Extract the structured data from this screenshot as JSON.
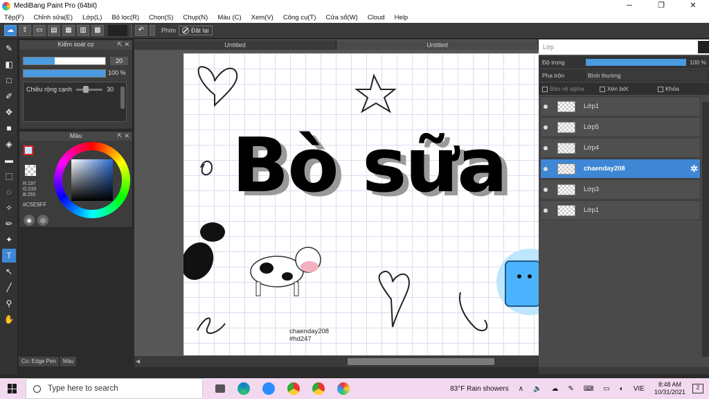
{
  "window": {
    "title": "MediBang Paint Pro (64bit)",
    "minimize": "─",
    "maximize": "❐",
    "close": "✕"
  },
  "menu": [
    "Tệp(F)",
    "Chỉnh sửa(E)",
    "Lớp(L)",
    "Bộ lọc(R)",
    "Chọn(S)",
    "Chụp(N)",
    "Màu (C)",
    "Xem(V)",
    "Công cụ(T)",
    "Cửa sổ(W)",
    "Cloud",
    "Help"
  ],
  "toolbar": {
    "label": "Phím",
    "reset": "Đặt lại"
  },
  "brush_panel": {
    "title": "Kiểm soát cọ",
    "size_value": "20",
    "size_fraction": 0.38,
    "opacity_value": "100 %",
    "opacity_fraction": 1.0,
    "width_label": "Chiều rộng cạnh",
    "width_value": "30"
  },
  "color_panel": {
    "title": "Màu",
    "rgb": "R:197\nG:233\nB:255",
    "hex": "#C5E9FF",
    "fg_color": "#c5e9ff"
  },
  "bottom_tabs": [
    "Co: Edge Pen",
    "Màu"
  ],
  "tabs": [
    "Untitled",
    "Untitled"
  ],
  "canvas": {
    "title_text": "Bò sữa",
    "watermark_line1": "chaenday208",
    "watermark_line2": "#hd247"
  },
  "layers": {
    "title": "Lớp",
    "opacity_label": "Độ trong",
    "opacity_value": "100 %",
    "blend_label": "Pha trộn",
    "blend_value": "Bình thường",
    "protect_alpha": "Bảo vệ alpha",
    "clip": "Xén bớt",
    "lock": "Khóa",
    "items": [
      {
        "name": "Lớp1",
        "selected": false
      },
      {
        "name": "Lớp5",
        "selected": false
      },
      {
        "name": "Lớp4",
        "selected": false
      },
      {
        "name": "chaenday208",
        "selected": true
      },
      {
        "name": "Lớp3",
        "selected": false
      },
      {
        "name": "Lớp1",
        "selected": false
      }
    ]
  },
  "taskbar": {
    "search_placeholder": "Type here to search",
    "weather": "83°F  Rain showers",
    "lang": "VIE",
    "time": "8:48 AM",
    "date": "10/31/2021",
    "notif_count": "2"
  }
}
